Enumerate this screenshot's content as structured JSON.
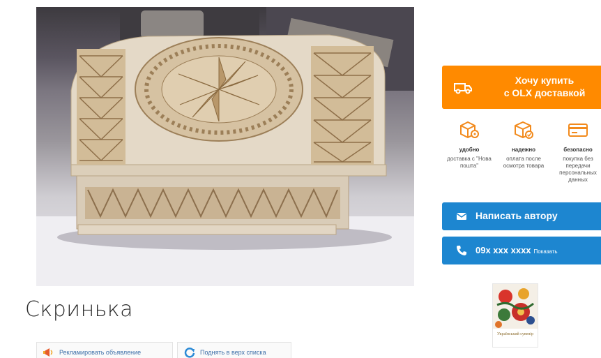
{
  "listing": {
    "title": "Скринька",
    "photo_icon": "carved-wooden-box-photo"
  },
  "promotions": {
    "advertise_label": "Рекламировать объявление",
    "advertise_icon": "megaphone-icon",
    "raise_label": "Поднять в верх списка",
    "raise_icon": "refresh-icon"
  },
  "buy": {
    "line1": "Хочу купить",
    "line2": "с OLX доставкой",
    "icon": "delivery-truck-icon",
    "color": "#ff8a00"
  },
  "features": [
    {
      "head": "удобно",
      "body": "доставка с \"Нова пошта\"",
      "icon": "location-box-icon"
    },
    {
      "head": "надежно",
      "body": "оплата после осмотра товара",
      "icon": "box-check-icon"
    },
    {
      "head": "безопасно",
      "body": "покупка без передачи персональных данных",
      "icon": "card-icon"
    }
  ],
  "contact": {
    "write_label": "Написать автору",
    "write_icon": "envelope-icon",
    "phone_label": "09x xxx xxxx",
    "show_label": "Показать",
    "phone_icon": "phone-icon",
    "color": "#1d86d0"
  },
  "shop": {
    "caption": "Український сувенір"
  }
}
